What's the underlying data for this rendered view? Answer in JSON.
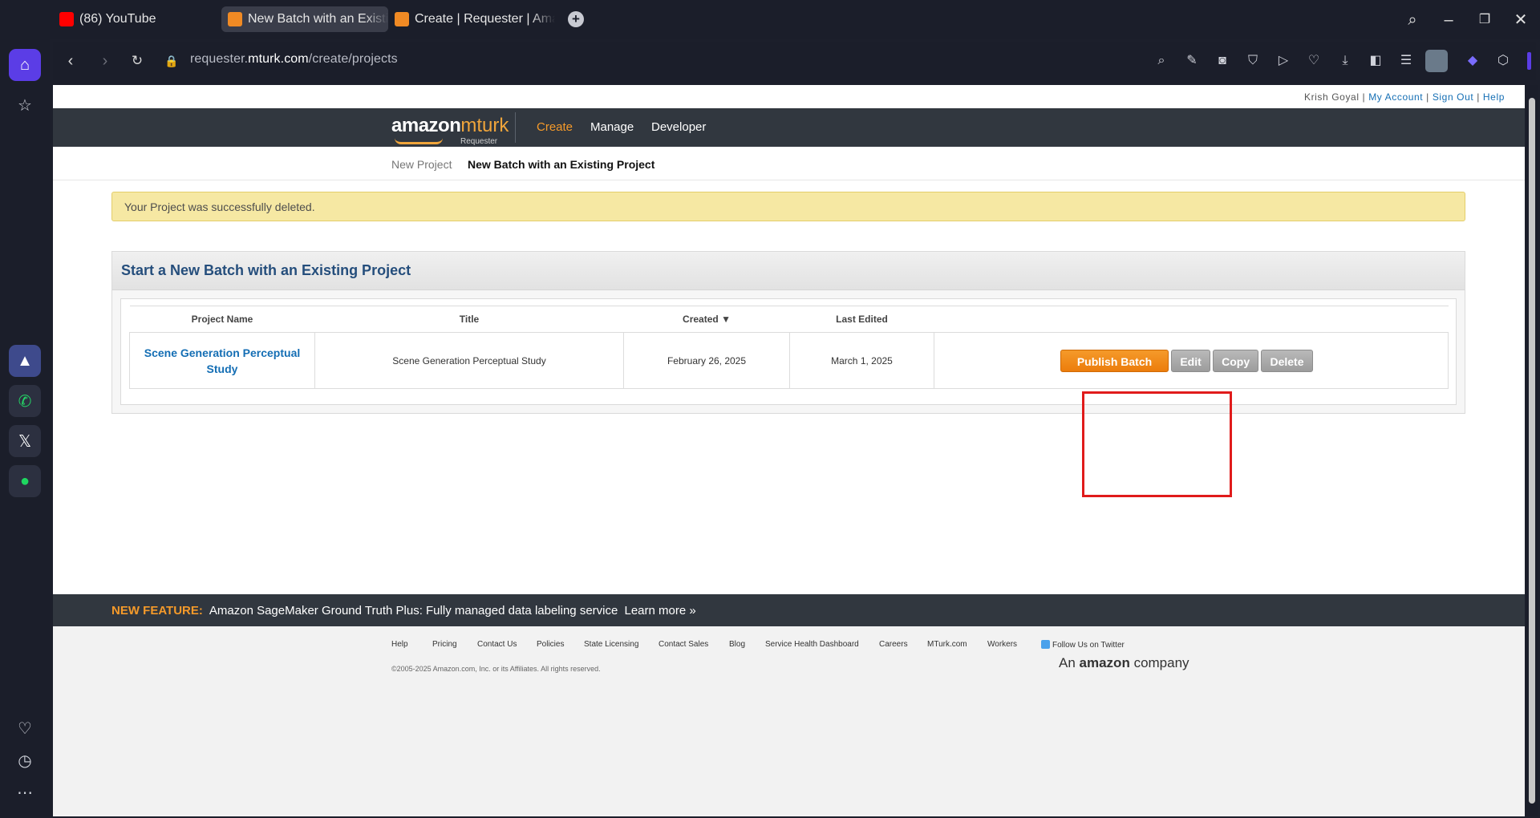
{
  "browser": {
    "tabs": [
      {
        "label": "(86) YouTube"
      },
      {
        "label": "New Batch with an Existing"
      },
      {
        "label": "Create | Requester | Amazo"
      }
    ],
    "url_prefix": "requester.",
    "url_domain": "mturk.com",
    "url_path": "/create/projects"
  },
  "account": {
    "user": "Krish Goyal",
    "my_account": "My Account",
    "sign_out": "Sign Out",
    "help": "Help",
    "sep": " | "
  },
  "header": {
    "logo_word1": "amazon",
    "logo_word2": "mturk",
    "logo_sub": "Requester",
    "nav": [
      "Create",
      "Manage",
      "Developer"
    ]
  },
  "subnav": {
    "items": [
      "New Project",
      "New Batch with an Existing Project"
    ]
  },
  "alert": {
    "message": "Your Project was successfully deleted."
  },
  "panel": {
    "title": "Start a New Batch with an Existing Project",
    "columns": [
      "Project Name",
      "Title",
      "Created ▼",
      "Last Edited",
      ""
    ],
    "rows": [
      {
        "project_name": "Scene Generation Perceptual Study",
        "title": "Scene Generation Perceptual Study",
        "created": "February 26, 2025",
        "last_edited": "March 1, 2025",
        "actions": {
          "publish": "Publish Batch",
          "edit": "Edit",
          "copy": "Copy",
          "delete": "Delete"
        }
      }
    ]
  },
  "feature": {
    "tag": "NEW FEATURE:",
    "text": "Amazon SageMaker Ground Truth Plus: Fully managed data labeling service",
    "link": "Learn more »"
  },
  "footer": {
    "links": [
      "Help",
      "Pricing",
      "Contact Us",
      "Policies",
      "State Licensing",
      "Contact Sales",
      "Blog",
      "Service Health Dashboard",
      "Careers",
      "MTurk.com",
      "Workers",
      "Follow Us on Twitter"
    ],
    "copyright": "©2005-2025 Amazon.com, Inc. or its Affiliates. All rights reserved.",
    "company_prefix": "An",
    "company_name": "amazon",
    "company_suffix": "company"
  },
  "colors": {
    "accent_orange": "#f59a2a",
    "link_blue": "#146eb4",
    "header_dark": "#31373f",
    "highlight_red": "#e01b1b"
  }
}
